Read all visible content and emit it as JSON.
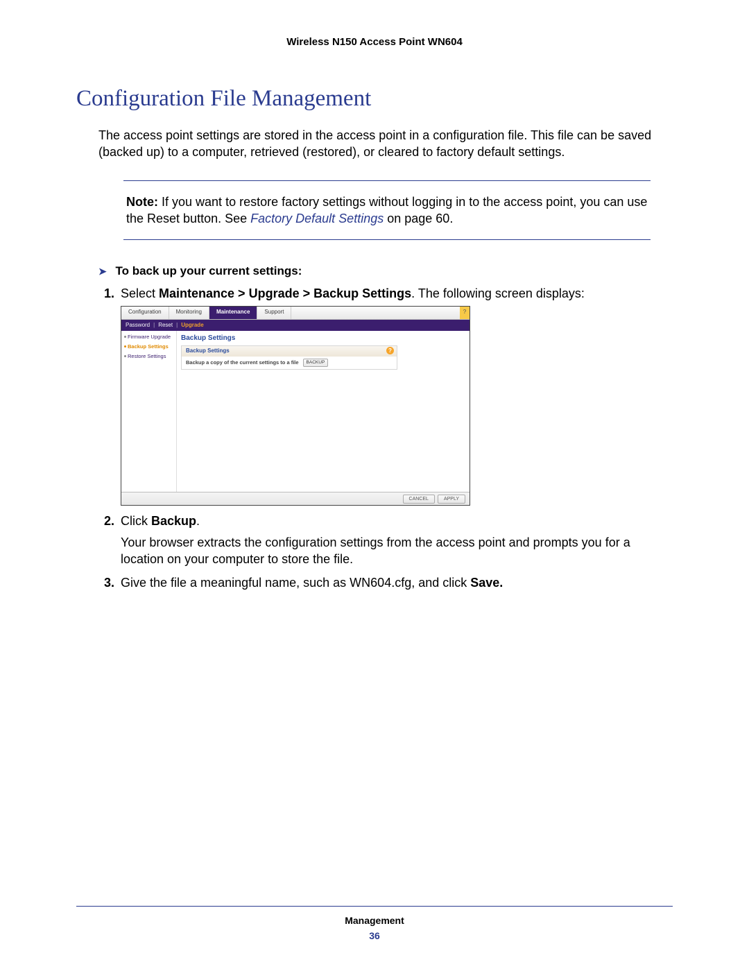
{
  "doc_header": "Wireless N150 Access Point WN604",
  "section_title": "Configuration File Management",
  "intro": "The access point settings are stored in the access point in a configuration file. This file can be saved (backed up) to a computer, retrieved (restored), or cleared to factory default settings.",
  "note": {
    "label": "Note:",
    "body_before": "If you want to restore factory settings without logging in to the access point, you can use the Reset button. See ",
    "link": "Factory Default Settings",
    "body_after": " on page 60."
  },
  "procedure": {
    "heading": "To back up your current settings:",
    "steps": {
      "s1_pre": "Select ",
      "s1_bold": "Maintenance > Upgrade > Backup Settings",
      "s1_post": ". The following screen displays:",
      "s2_pre": "Click ",
      "s2_bold": "Backup",
      "s2_post": ".",
      "s2_sub": "Your browser extracts the configuration settings from the access point and prompts you for a location on your computer to store the file.",
      "s3_pre": "Give the file a meaningful name, such as WN604.cfg, and click ",
      "s3_bold": "Save.",
      "s3_post": ""
    }
  },
  "screenshot": {
    "tabs": [
      "Configuration",
      "Monitoring",
      "Maintenance",
      "Support"
    ],
    "active_tab_index": 2,
    "subnav": [
      "Password",
      "Reset",
      "Upgrade"
    ],
    "subnav_active_index": 2,
    "side_items": [
      "Firmware Upgrade",
      "Backup Settings",
      "Restore Settings"
    ],
    "side_active_index": 1,
    "panel_title": "Backup Settings",
    "panel_header": "Backup Settings",
    "panel_row_text": "Backup a copy of the current settings to a file",
    "panel_row_button": "BACKUP",
    "footer_buttons": [
      "CANCEL",
      "APPLY"
    ],
    "help_glyph": "?"
  },
  "footer": {
    "section": "Management",
    "page": "36"
  }
}
